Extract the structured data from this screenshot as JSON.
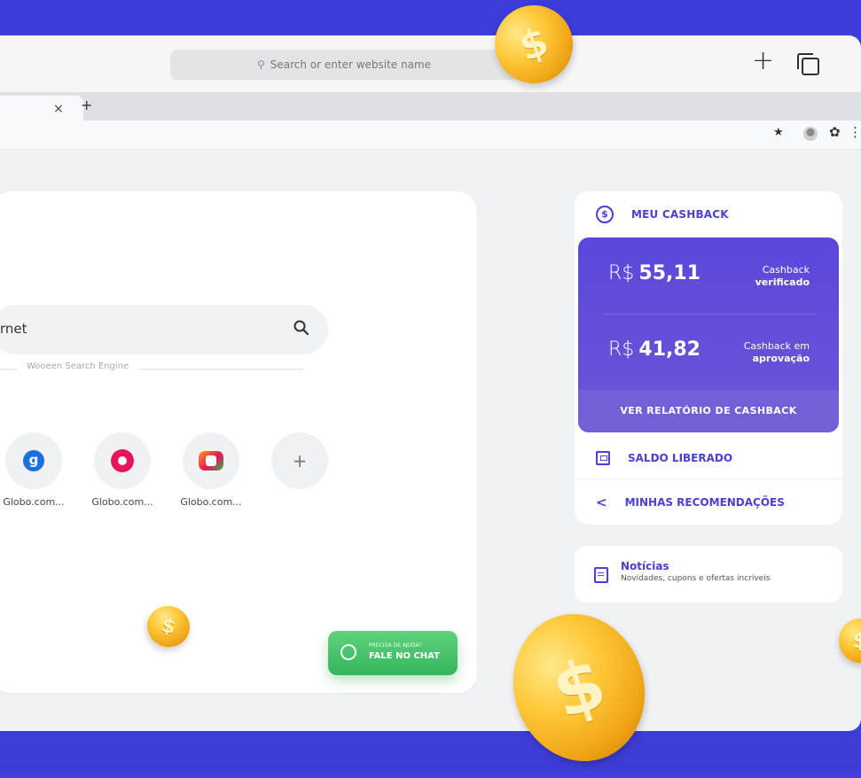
{
  "browser": {
    "url_placeholder": "Search or enter website name",
    "back_glyph": "‹",
    "forward_glyph": "›",
    "new_tab_glyph": "+",
    "tab_close_glyph": "×",
    "tab_add_glyph": "+"
  },
  "toolbar": {
    "star_glyph": "★",
    "gear_glyph": "✿",
    "menu_glyph": "⋮"
  },
  "main": {
    "search_text": "rnet",
    "engine_label": "Wooeen Search Engine",
    "shortcuts": [
      {
        "label": "Globo.com...",
        "icon": "g-logo-icon"
      },
      {
        "label": "Globo.com...",
        "icon": "swirl-logo-icon"
      },
      {
        "label": "Globo.com...",
        "icon": "tv-logo-icon"
      },
      {
        "label": "",
        "icon": "add-icon",
        "glyph": "+"
      }
    ],
    "chat": {
      "small": "PRECISA DE AJUDA?",
      "big": "FALE NO CHAT"
    }
  },
  "cashback": {
    "title": "MEU CASHBACK",
    "currency": "R$",
    "verified_value": "55,11",
    "verified_caption_top": "Cashback",
    "verified_caption_bottom": "verificado",
    "pending_value": "41,82",
    "pending_caption_top": "Cashback em",
    "pending_caption_bottom": "aprovação",
    "report_button": "VER RELATÓRIO DE CASHBACK",
    "saldo_label": "SALDO LIBERADO",
    "recomendacoes_label": "MINHAS RECOMENDAÇÕES"
  },
  "news": {
    "title": "Notícias",
    "subtitle": "Novidades, cupons e ofertas incríveis"
  },
  "colors": {
    "background": "#3f3fd9",
    "accent": "#4a3fd6",
    "cashback_panel": "#5a48dc",
    "chat_green": "#35b55c",
    "coin_gold": "#ffc93a"
  }
}
